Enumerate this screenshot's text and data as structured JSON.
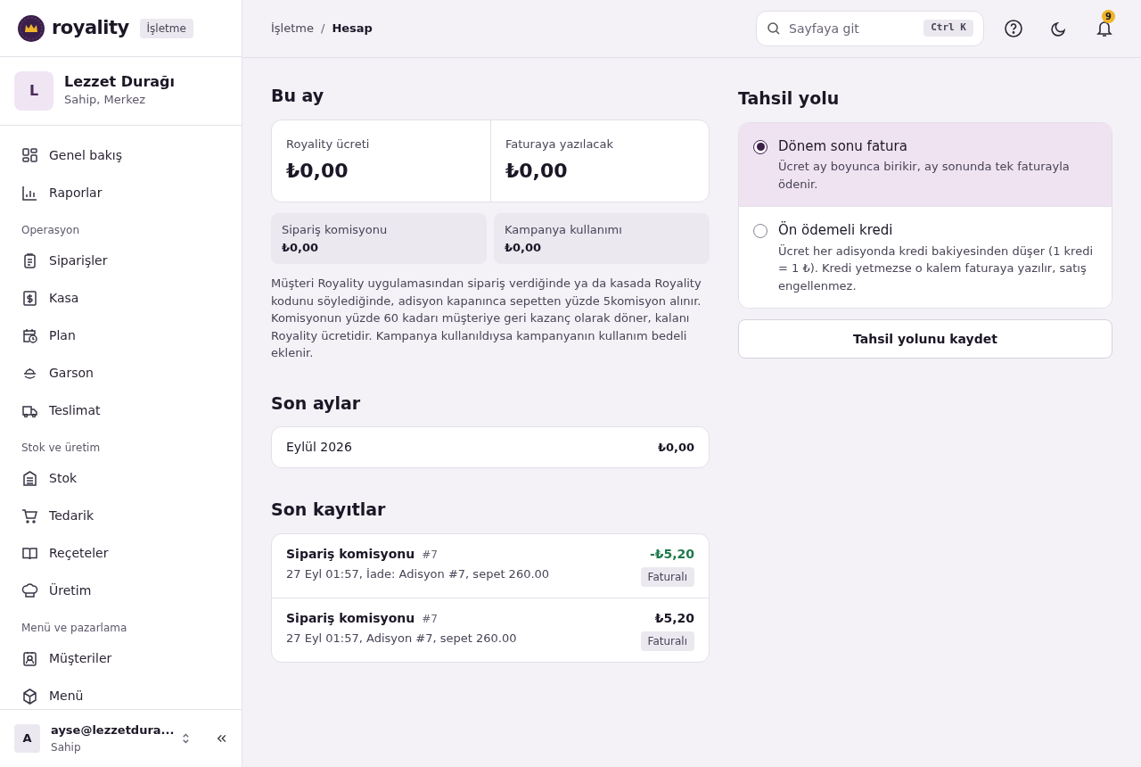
{
  "brand": {
    "name": "royality",
    "badge": "İşletme"
  },
  "business": {
    "initial": "L",
    "name": "Lezzet Durağı",
    "role": "Sahip, Merkez"
  },
  "sidebar": {
    "sections": [
      {
        "items": [
          {
            "label": "Genel bakış"
          },
          {
            "label": "Raporlar"
          }
        ]
      },
      {
        "title": "Operasyon",
        "items": [
          {
            "label": "Siparişler"
          },
          {
            "label": "Kasa"
          },
          {
            "label": "Plan"
          },
          {
            "label": "Garson"
          },
          {
            "label": "Teslimat"
          }
        ]
      },
      {
        "title": "Stok ve üretim",
        "items": [
          {
            "label": "Stok"
          },
          {
            "label": "Tedarik"
          },
          {
            "label": "Reçeteler"
          },
          {
            "label": "Üretim"
          }
        ]
      },
      {
        "title": "Menü ve pazarlama",
        "items": [
          {
            "label": "Müşteriler"
          },
          {
            "label": "Menü"
          }
        ]
      }
    ]
  },
  "user": {
    "initial": "A",
    "email": "ayse@lezzetdura...",
    "role": "Sahip"
  },
  "breadcrumb": [
    "İşletme",
    "/",
    "Hesap"
  ],
  "search": {
    "placeholder": "Sayfaya git",
    "shortcut": "Ctrl K"
  },
  "notifications": {
    "count": "9"
  },
  "this_month": {
    "title": "Bu ay",
    "stats": [
      {
        "label": "Royality ücreti",
        "value": "₺0,00"
      },
      {
        "label": "Faturaya yazılacak",
        "value": "₺0,00"
      }
    ],
    "breakdown": [
      {
        "label": "Sipariş komisyonu",
        "value": "₺0,00"
      },
      {
        "label": "Kampanya kullanımı",
        "value": "₺0,00"
      }
    ],
    "note": "Müşteri Royality uygulamasından sipariş verdiğinde ya da kasada Royality kodunu söylediğinde, adisyon kapanınca sepetten yüzde 5komisyon alınır. Komisyonun yüzde 60 kadarı müşteriye geri kazanç olarak döner, kalanı Royality ücretidir. Kampanya kullanıldıysa kampanyanın kullanım bedeli eklenir."
  },
  "recent_months": {
    "title": "Son aylar",
    "rows": [
      {
        "month": "Eylül 2026",
        "amount": "₺0,00"
      }
    ]
  },
  "recent_entries": {
    "title": "Son kayıtlar",
    "rows": [
      {
        "title": "Sipariş komisyonu",
        "ref": "#7",
        "detail": "27 Eyl 01:57, İade: Adisyon #7, sepet 260.00",
        "amount": "-₺5,20",
        "kind": "credit",
        "badge": "Faturalı"
      },
      {
        "title": "Sipariş komisyonu",
        "ref": "#7",
        "detail": "27 Eyl 01:57, Adisyon #7, sepet 260.00",
        "amount": "₺5,20",
        "kind": "debit",
        "badge": "Faturalı"
      }
    ]
  },
  "payment_method": {
    "title": "Tahsil yolu",
    "options": [
      {
        "label": "Dönem sonu fatura",
        "description": "Ücret ay boyunca birikir, ay sonunda tek faturayla ödenir.",
        "selected": true
      },
      {
        "label": "Ön ödemeli kredi",
        "description": "Ücret her adisyonda kredi bakiyesinden düşer (1 kredi = 1 ₺). Kredi yetmezse o kalem faturaya yazılır, satış engellenmez.",
        "selected": false
      }
    ],
    "save_button": "Tahsil yolunu kaydet"
  }
}
